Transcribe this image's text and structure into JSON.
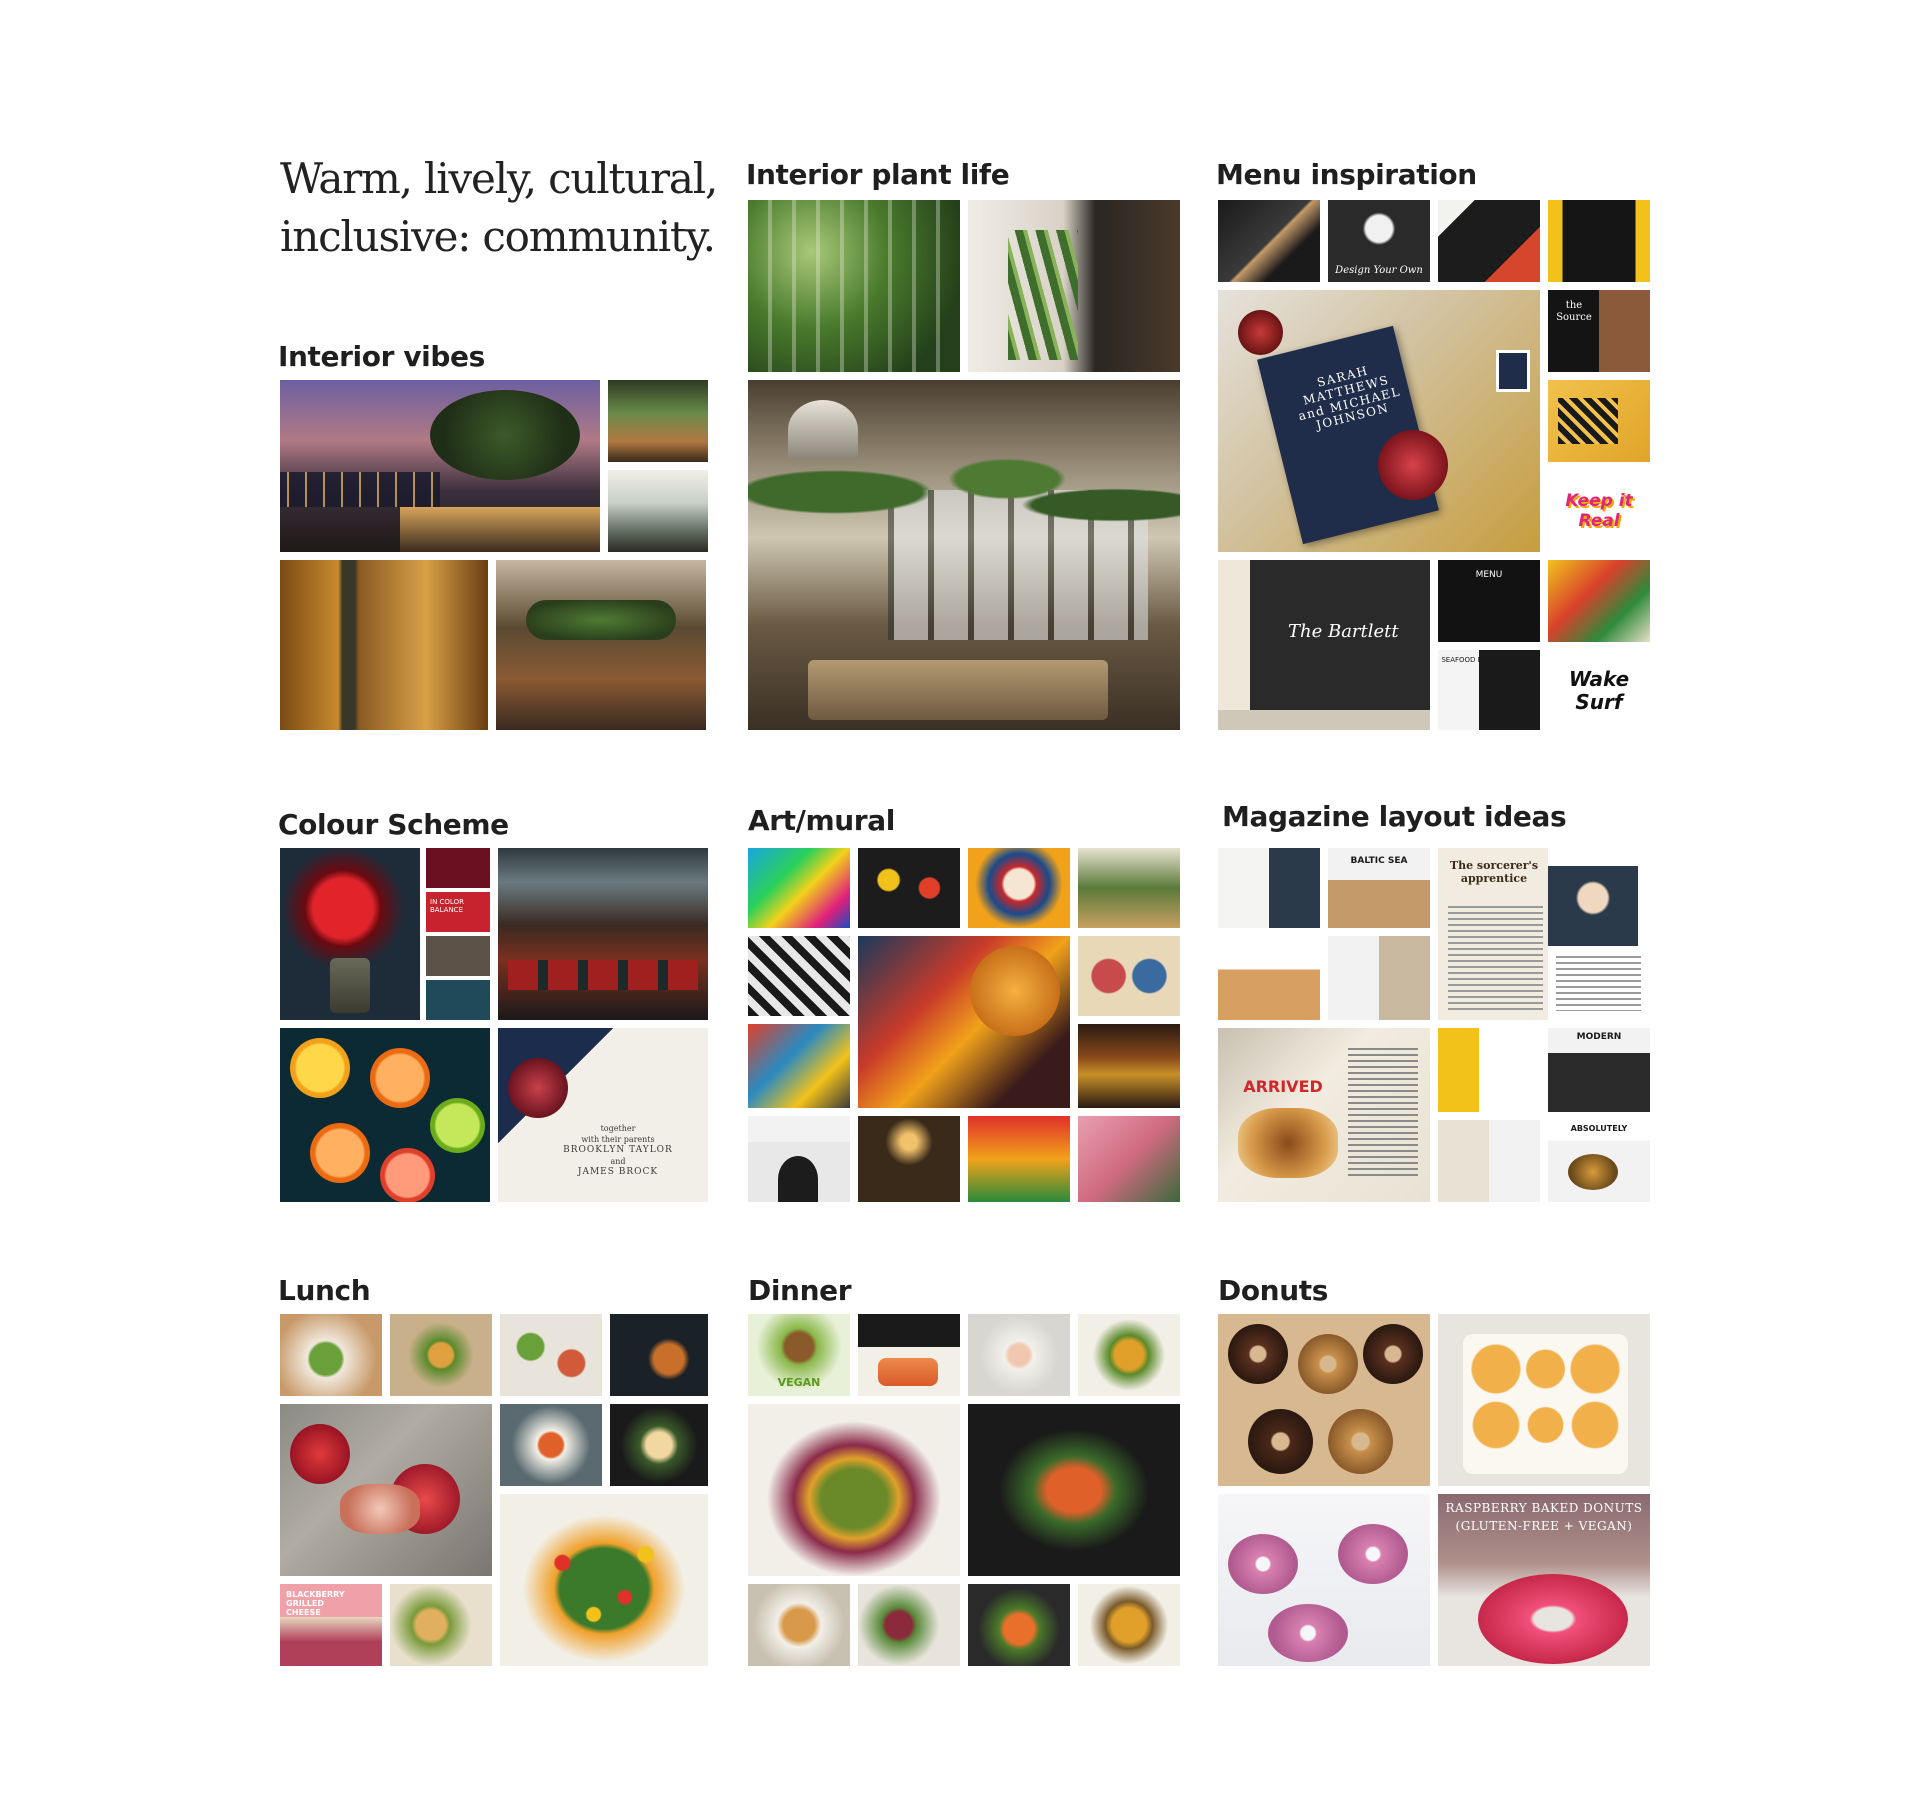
{
  "tagline": {
    "line1": "Warm, lively, cultural,",
    "line2": "inclusive: community."
  },
  "boards": {
    "interior_vibes": {
      "title": "Interior vibes"
    },
    "interior_plant_life": {
      "title": "Interior plant life"
    },
    "menu_inspiration": {
      "title": "Menu inspiration",
      "texts": {
        "invite_names": "SARAH MATTHEWS and MICHAEL JOHNSON",
        "design_your_own": "Design Your Own",
        "keep_it_real": "Keep it Real",
        "the_bartlett": "The Bartlett",
        "menu": "MENU",
        "seafood_menu_template": "SEAFOOD MENU TEMPLATE",
        "wake_surf": "Wake Surf",
        "the_source": "the Source"
      }
    },
    "colour_scheme": {
      "title": "Colour Scheme",
      "swatches": [
        "#6b1020",
        "#c8232c",
        "#5c5248",
        "#1f4a5a"
      ],
      "swatch_label": "IN COLOR BALANCE",
      "invite_text": {
        "l1": "together",
        "l2": "with their parents",
        "l3": "BROOKLYN TAYLOR",
        "l4": "and",
        "l5": "JAMES BROCK"
      }
    },
    "art_mural": {
      "title": "Art/mural"
    },
    "magazine_layout": {
      "title": "Magazine layout ideas",
      "texts": {
        "baltic_sea": "BALTIC SEA",
        "sorcerer": "The sorcerer's apprentice",
        "arrived": "ARRIVED",
        "modern": "MODERN",
        "absolutely": "ABSOLUTELY"
      }
    },
    "lunch": {
      "title": "Lunch",
      "texts": {
        "blackberry": "BLACKBERRY GRILLED CHEESE"
      }
    },
    "dinner": {
      "title": "Dinner",
      "texts": {
        "vegan": "VEGAN"
      }
    },
    "donuts": {
      "title": "Donuts",
      "texts": {
        "raspberry_l1": "RASPBERRY BAKED DONUTS",
        "raspberry_l2": "(GLUTEN-FREE + VEGAN)"
      }
    }
  }
}
